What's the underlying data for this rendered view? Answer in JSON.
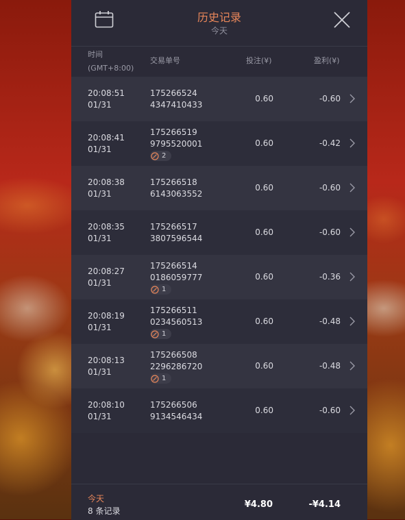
{
  "header": {
    "title": "历史记录",
    "subtitle": "今天",
    "calendar_icon": "calendar-icon",
    "close_icon": "close-icon"
  },
  "columns": {
    "time_line1": "时间",
    "time_line2": "(GMT+8:00)",
    "order": "交易单号",
    "bet": "投注(¥)",
    "profit": "盈利(¥)"
  },
  "rows": [
    {
      "time": "20:08:51",
      "date": "01/31",
      "order1": "175266524",
      "order2": "4347410433",
      "badge": "",
      "bet": "0.60",
      "profit": "-0.60"
    },
    {
      "time": "20:08:41",
      "date": "01/31",
      "order1": "175266519",
      "order2": "9795520001",
      "badge": "2",
      "bet": "0.60",
      "profit": "-0.42"
    },
    {
      "time": "20:08:38",
      "date": "01/31",
      "order1": "175266518",
      "order2": "6143063552",
      "badge": "",
      "bet": "0.60",
      "profit": "-0.60"
    },
    {
      "time": "20:08:35",
      "date": "01/31",
      "order1": "175266517",
      "order2": "3807596544",
      "badge": "",
      "bet": "0.60",
      "profit": "-0.60"
    },
    {
      "time": "20:08:27",
      "date": "01/31",
      "order1": "175266514",
      "order2": "0186059777",
      "badge": "1",
      "bet": "0.60",
      "profit": "-0.36"
    },
    {
      "time": "20:08:19",
      "date": "01/31",
      "order1": "175266511",
      "order2": "0234560513",
      "badge": "1",
      "bet": "0.60",
      "profit": "-0.48"
    },
    {
      "time": "20:08:13",
      "date": "01/31",
      "order1": "175266508",
      "order2": "2296286720",
      "badge": "1",
      "bet": "0.60",
      "profit": "-0.48"
    },
    {
      "time": "20:08:10",
      "date": "01/31",
      "order1": "175266506",
      "order2": "9134546434",
      "badge": "",
      "bet": "0.60",
      "profit": "-0.60"
    }
  ],
  "footer": {
    "label": "今天",
    "count": "8 条记录",
    "total_bet": "¥4.80",
    "total_profit": "-¥4.14"
  },
  "colors": {
    "accent": "#e9875a",
    "panel": "#2b2a37",
    "row_odd": "#343441",
    "row_even": "#2d2d3a"
  }
}
